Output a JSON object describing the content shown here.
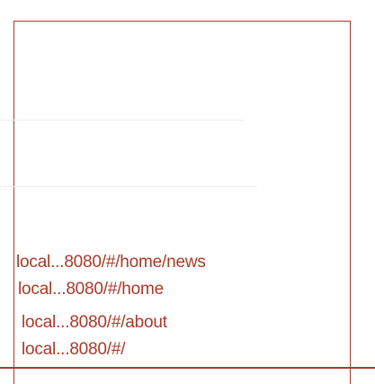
{
  "history": {
    "entries": [
      "local...8080/#/home/news",
      "local...8080/#/home",
      "local...8080/#/about",
      "local...8080/#/"
    ]
  },
  "colors": {
    "accent": "#a93a2a",
    "divider": "#eeeeee",
    "background": "#ffffff"
  }
}
